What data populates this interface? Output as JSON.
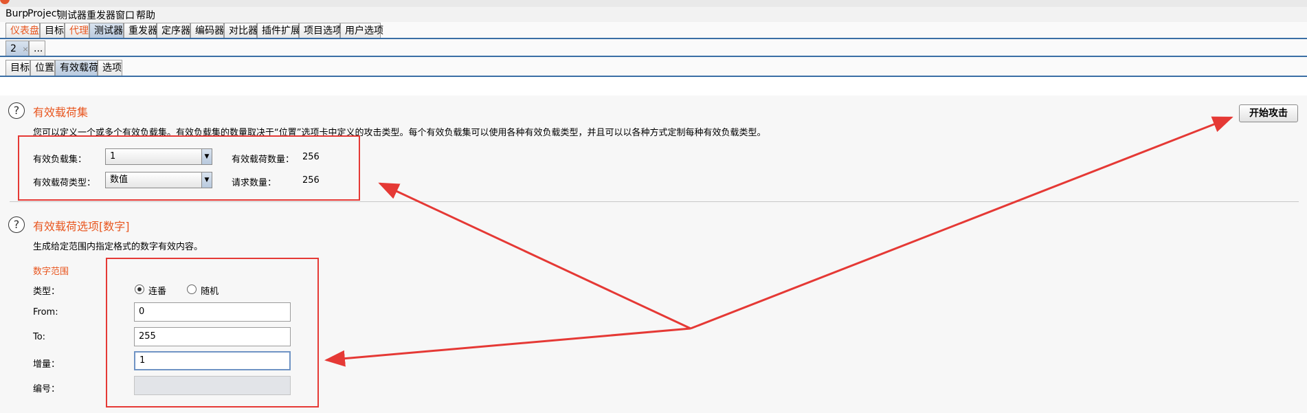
{
  "menu": [
    "Burp",
    "Project",
    "测试器",
    "重发器",
    "窗口",
    "帮助"
  ],
  "main_tabs": [
    {
      "label": "仪表盘",
      "style": "orange"
    },
    {
      "label": "目标",
      "style": "normal"
    },
    {
      "label": "代理",
      "style": "orange"
    },
    {
      "label": "测试器",
      "style": "active"
    },
    {
      "label": "重发器",
      "style": "normal"
    },
    {
      "label": "定序器",
      "style": "normal"
    },
    {
      "label": "编码器",
      "style": "normal"
    },
    {
      "label": "对比器",
      "style": "normal"
    },
    {
      "label": "插件扩展",
      "style": "normal"
    },
    {
      "label": "项目选项",
      "style": "normal"
    },
    {
      "label": "用户选项",
      "style": "normal"
    }
  ],
  "attack_tabs": {
    "tab1": "2",
    "close": "×",
    "more": "..."
  },
  "sub_tabs": [
    "目标",
    "位置",
    "有效载荷",
    "选项"
  ],
  "payload_sets": {
    "title": "有效载荷集",
    "description": "您可以定义一个或多个有效负载集。有效负载集的数量取决于“位置”选项卡中定义的攻击类型。每个有效负载集可以使用各种有效负载类型，并且可以以各种方式定制每种有效负载类型。",
    "set_label": "有效负载集：",
    "set_value": "1",
    "type_label": "有效载荷类型：",
    "type_value": "数值",
    "count_label": "有效载荷数量：",
    "count_value": "256",
    "requests_label": "请求数量：",
    "requests_value": "256"
  },
  "start_button": "开始攻击",
  "payload_options": {
    "title": "有效载荷选项[数字]",
    "description": "生成给定范围内指定格式的数字有效内容。",
    "range_header": "数字范围",
    "type_label": "类型：",
    "radio_sequential": "连番",
    "radio_random": "随机",
    "selected": "sequential",
    "from_label": "From:",
    "from_value": "0",
    "to_label": "To:",
    "to_value": "255",
    "step_label": "增量：",
    "step_value": "1",
    "number_label": "编号：",
    "number_value": ""
  },
  "colors": {
    "accent": "#e8561f",
    "annotation": "#e53935",
    "tab_active": "#b8c9de"
  },
  "help_icon_glyph": "?"
}
